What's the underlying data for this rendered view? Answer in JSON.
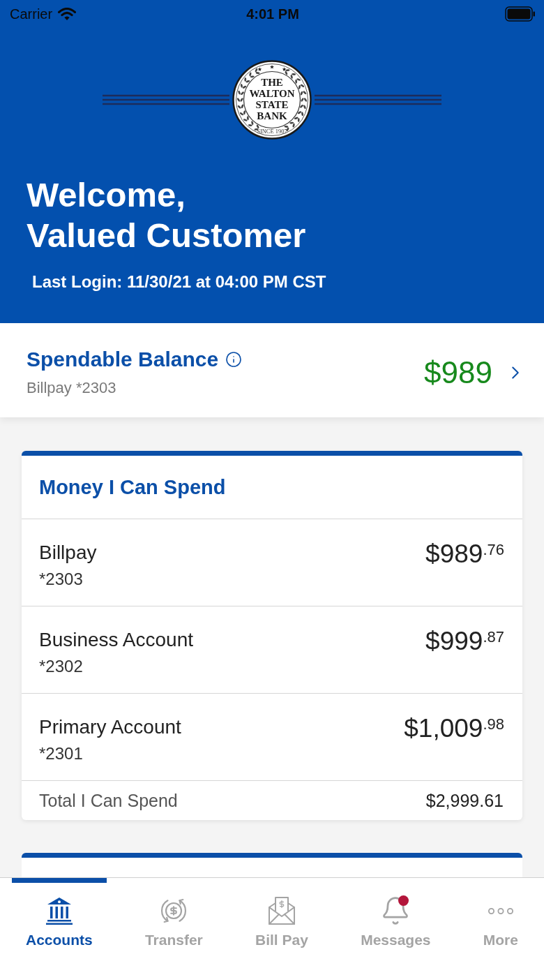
{
  "status_bar": {
    "carrier": "Carrier",
    "time": "4:01 PM"
  },
  "header": {
    "logo": {
      "lines": [
        "THE",
        "WALTON",
        "STATE",
        "BANK"
      ],
      "motto": "SINCE 1907"
    },
    "welcome_lines": [
      "Welcome,",
      "Valued Customer"
    ],
    "last_login": "Last Login: 11/30/21 at 04:00 PM CST"
  },
  "spendable_balance": {
    "title": "Spendable Balance",
    "account": "Billpay *2303",
    "amount": "$989"
  },
  "money_card": {
    "title": "Money I Can Spend",
    "accounts": [
      {
        "name": "Billpay",
        "number": "*2303",
        "amount": "$989",
        "cents": ".76"
      },
      {
        "name": "Business Account",
        "number": "*2302",
        "amount": "$999",
        "cents": ".87"
      },
      {
        "name": "Primary Account",
        "number": "*2301",
        "amount": "$1,009",
        "cents": ".98"
      }
    ],
    "total_label": "Total I Can Spend",
    "total_amount": "$2,999.61"
  },
  "tab_bar": {
    "tabs": [
      {
        "kind": "accounts",
        "label": "Accounts",
        "selected": true,
        "alert": false
      },
      {
        "kind": "transfer",
        "label": "Transfer",
        "selected": false,
        "alert": false
      },
      {
        "kind": "billpay",
        "label": "Bill Pay",
        "selected": false,
        "alert": false
      },
      {
        "kind": "messages",
        "label": "Messages",
        "selected": false,
        "alert": true
      },
      {
        "kind": "more",
        "label": "More",
        "selected": false,
        "alert": false
      }
    ]
  }
}
